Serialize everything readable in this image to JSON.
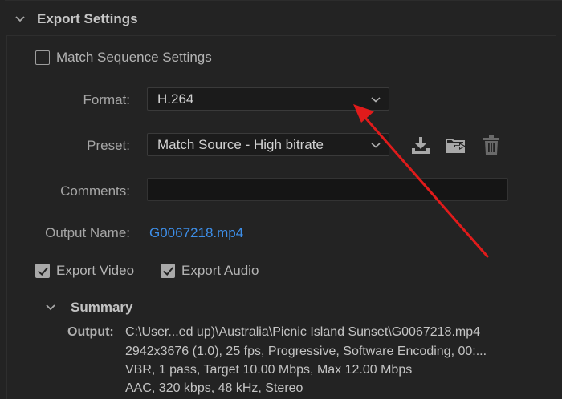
{
  "section": {
    "title": "Export Settings"
  },
  "match_sequence": {
    "label": "Match Sequence Settings",
    "checked": false
  },
  "format": {
    "label": "Format:",
    "value": "H.264"
  },
  "preset": {
    "label": "Preset:",
    "value": "Match Source - High bitrate",
    "icons": [
      "save-preset-icon",
      "import-preset-icon",
      "delete-preset-icon"
    ]
  },
  "comments": {
    "label": "Comments:",
    "value": ""
  },
  "output_name": {
    "label": "Output Name:",
    "value": "G0067218.mp4"
  },
  "export_video": {
    "label": "Export Video",
    "checked": true
  },
  "export_audio": {
    "label": "Export Audio",
    "checked": true
  },
  "summary": {
    "title": "Summary",
    "output_label": "Output:",
    "lines": [
      "C:\\User...ed up)\\Australia\\Picnic Island Sunset\\G0067218.mp4",
      "2942x3676 (1.0), 25 fps, Progressive, Software Encoding, 00:...",
      "VBR, 1 pass, Target 10.00 Mbps, Max 12.00 Mbps",
      "AAC, 320 kbps, 48 kHz, Stereo"
    ]
  },
  "colors": {
    "background": "#232323",
    "link": "#3d8ee8",
    "annotation_arrow": "#e01b1b"
  }
}
